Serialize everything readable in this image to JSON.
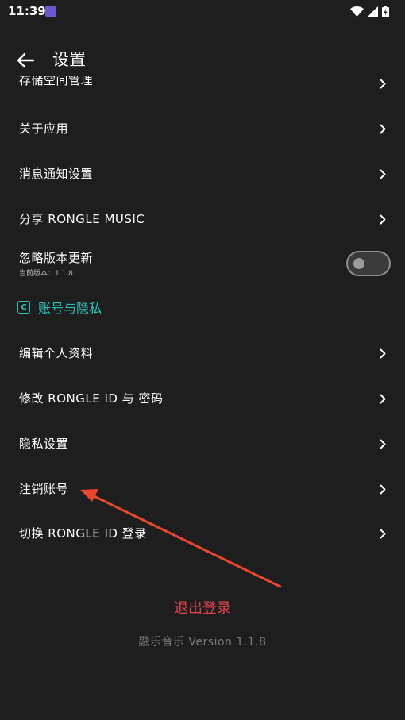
{
  "status_bar": {
    "time": "11:39"
  },
  "header": {
    "title": "设置"
  },
  "settings": {
    "storage_label": "存储空间管理",
    "about_label": "关于应用",
    "notification_label": "消息通知设置",
    "share_label": "分享 RONGLE MUSIC",
    "ignore_update_label": "忽略版本更新",
    "ignore_update_sub": "当前版本：1.1.8",
    "ignore_update_enabled": false
  },
  "account_section": {
    "icon_letter": "C",
    "title": "账号与隐私",
    "edit_profile_label": "编辑个人资料",
    "modify_id_label": "修改 RONGLE ID 与 密码",
    "privacy_label": "隐私设置",
    "cancel_account_label": "注销账号",
    "switch_id_label": "切换 RONGLE ID 登录"
  },
  "footer": {
    "logout_label": "退出登录",
    "version_text": "融乐音乐 Version 1.1.8"
  },
  "colors": {
    "background": "#1e1e1e",
    "accent": "#2bbfb5",
    "danger": "#e0424f",
    "annotation": "#e8462f"
  },
  "icons": {
    "back": "arrow-left-icon",
    "chevron": "chevron-right-icon",
    "wifi": "wifi-icon",
    "signal": "signal-icon",
    "battery": "battery-icon"
  }
}
